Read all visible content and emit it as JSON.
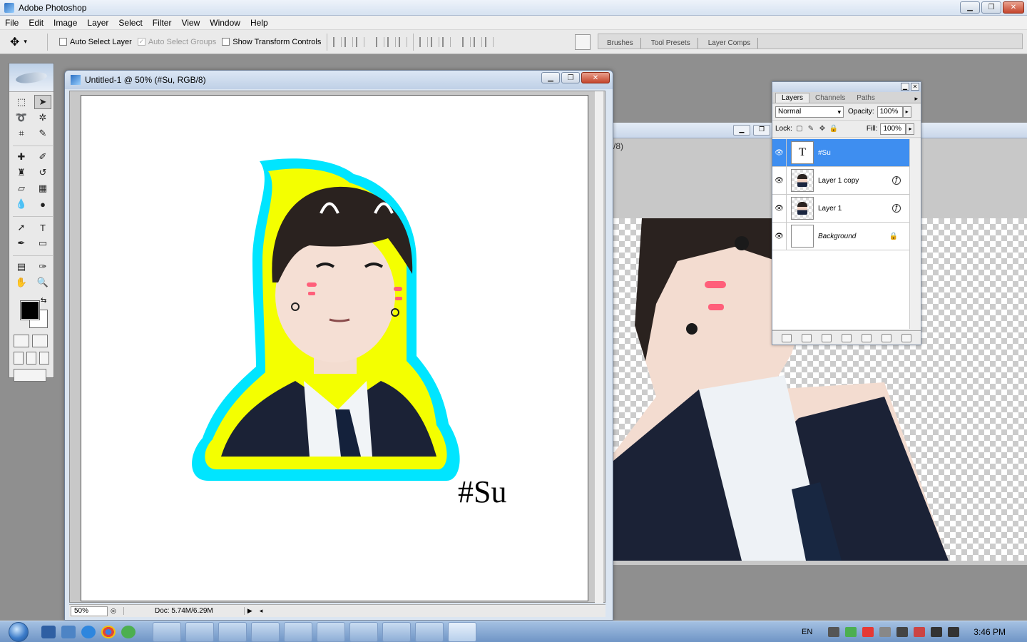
{
  "window": {
    "title": "Adobe Photoshop"
  },
  "menu": [
    "File",
    "Edit",
    "Image",
    "Layer",
    "Select",
    "Filter",
    "View",
    "Window",
    "Help"
  ],
  "options": {
    "auto_select_layer": "Auto Select Layer",
    "auto_select_groups": "Auto Select Groups",
    "show_transform_controls": "Show Transform Controls"
  },
  "palette_well": [
    "Brushes",
    "Tool Presets",
    "Layer Comps"
  ],
  "document": {
    "title": "Untitled-1 @ 50% (#Su, RGB/8)",
    "zoom": "50%",
    "doc_info": "Doc: 5.74M/6.29M",
    "text_layer_content": "#Su"
  },
  "document2": {
    "title_fragment": "/8)"
  },
  "layers_panel": {
    "tabs": [
      "Layers",
      "Channels",
      "Paths"
    ],
    "blend_mode": "Normal",
    "opacity_label": "Opacity:",
    "opacity": "100%",
    "lock_label": "Lock:",
    "fill_label": "Fill:",
    "fill": "100%",
    "layers": [
      {
        "name": "#Su",
        "type": "text",
        "selected": true
      },
      {
        "name": "Layer 1 copy",
        "type": "image",
        "fx": true
      },
      {
        "name": "Layer 1",
        "type": "image",
        "fx": true
      },
      {
        "name": "Background",
        "type": "background",
        "locked": true
      }
    ]
  },
  "taskbar": {
    "language": "EN",
    "time": "3:46 PM"
  },
  "colors": {
    "sticker_outer": "#00e5ff",
    "sticker_inner": "#f4ff00",
    "selected_layer": "#3e8ef0",
    "blush": "#ff5f7a"
  }
}
